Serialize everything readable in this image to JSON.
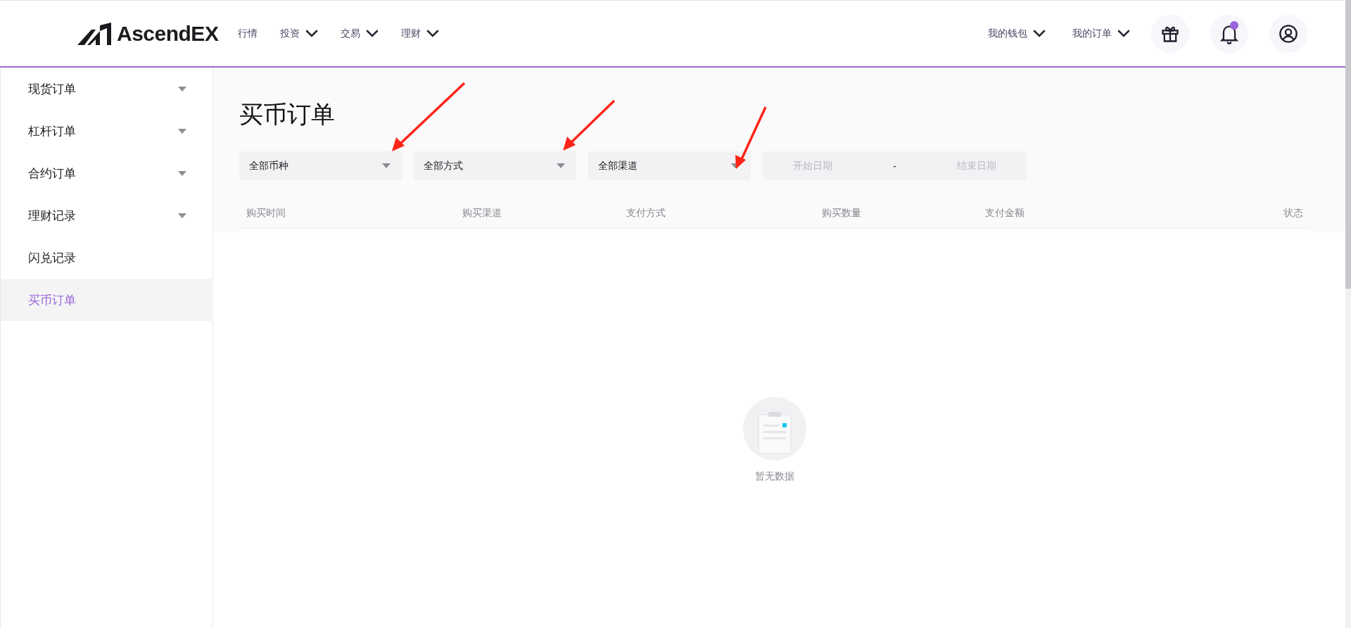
{
  "header": {
    "logo": "AscendEX",
    "nav": [
      {
        "label": "行情",
        "dropdown": false
      },
      {
        "label": "投资",
        "dropdown": true
      },
      {
        "label": "交易",
        "dropdown": true
      },
      {
        "label": "理财",
        "dropdown": true
      }
    ],
    "right_menu": [
      {
        "label": "我的钱包",
        "dropdown": true
      },
      {
        "label": "我的订单",
        "dropdown": true
      }
    ],
    "notification_unread": true
  },
  "sidebar": {
    "items": [
      {
        "label": "现货订单",
        "expandable": true,
        "selected": false
      },
      {
        "label": "杠杆订单",
        "expandable": true,
        "selected": false
      },
      {
        "label": "合约订单",
        "expandable": true,
        "selected": false
      },
      {
        "label": "理财记录",
        "expandable": true,
        "selected": false
      },
      {
        "label": "闪兑记录",
        "expandable": false,
        "selected": false
      },
      {
        "label": "买币订单",
        "expandable": false,
        "selected": true
      }
    ]
  },
  "main": {
    "title": "买币订单",
    "filters": [
      {
        "value": "全部币种"
      },
      {
        "value": "全部方式"
      },
      {
        "value": "全部渠道"
      }
    ],
    "date_range": {
      "start_placeholder": "开始日期",
      "separator": "-",
      "end_placeholder": "结束日期"
    },
    "table": {
      "columns": [
        "购买时间",
        "购买渠道",
        "支付方式",
        "购买数量",
        "支付金额",
        "状态"
      ]
    },
    "empty_text": "暂无数据"
  }
}
